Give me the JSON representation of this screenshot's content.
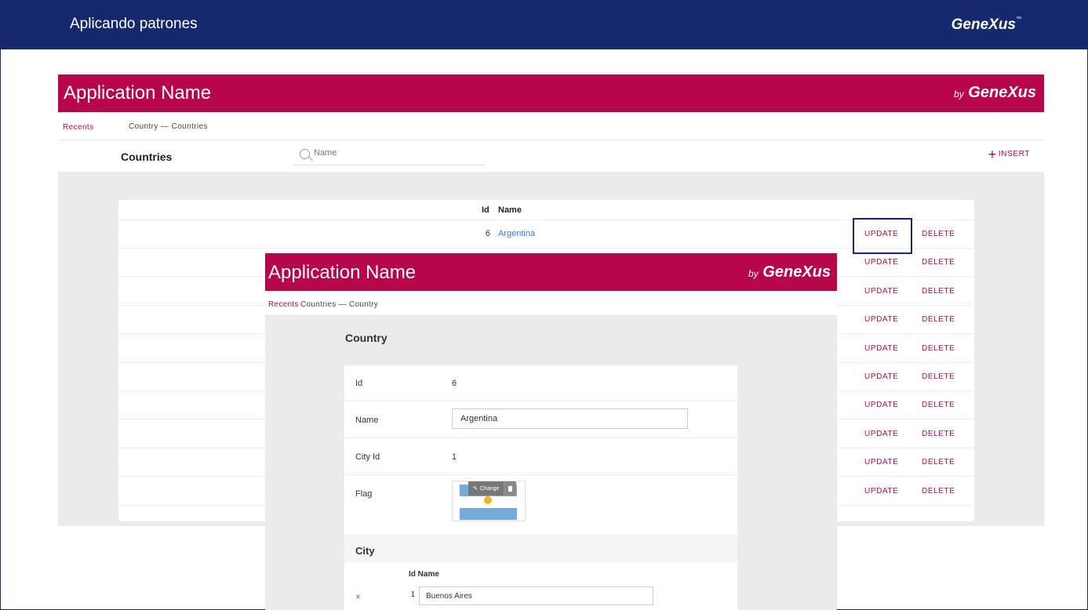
{
  "slide": {
    "title": "Aplicando patrones",
    "brand": "GeneXus",
    "brand_tm": "™"
  },
  "app": {
    "name": "Application Name",
    "by": "by",
    "brand": "GeneXus",
    "breadcrumb": {
      "recents": "Recents",
      "path": "Country — Countries"
    },
    "list_title": "Countries",
    "search": {
      "placeholder": "Name"
    },
    "insert_label": "INSERT",
    "grid": {
      "headers": {
        "id": "Id",
        "name": "Name"
      },
      "update_label": "UPDATE",
      "delete_label": "DELETE",
      "rows": [
        {
          "id": "6",
          "name": "Argentina"
        },
        {
          "id": "",
          "name": ""
        },
        {
          "id": "",
          "name": ""
        },
        {
          "id": "",
          "name": ""
        },
        {
          "id": "",
          "name": ""
        },
        {
          "id": "",
          "name": ""
        },
        {
          "id": "",
          "name": ""
        },
        {
          "id": "",
          "name": ""
        },
        {
          "id": "",
          "name": ""
        },
        {
          "id": "",
          "name": ""
        }
      ]
    }
  },
  "overlay": {
    "name": "Application Name",
    "by": "by",
    "brand": "GeneXus",
    "breadcrumb": {
      "recents": "Recents",
      "path": "Countries — Country"
    },
    "title": "Country",
    "fields": {
      "id_label": "Id",
      "id_value": "6",
      "name_label": "Name",
      "name_value": "Argentina",
      "city_id_label": "City Id",
      "city_id_value": "1",
      "flag_label": "Flag",
      "flag_change": "Change"
    },
    "city": {
      "title": "City",
      "header": "Id Name",
      "rows": [
        {
          "remove": "×",
          "id": "1",
          "name": "Buenos Aires"
        }
      ]
    }
  }
}
